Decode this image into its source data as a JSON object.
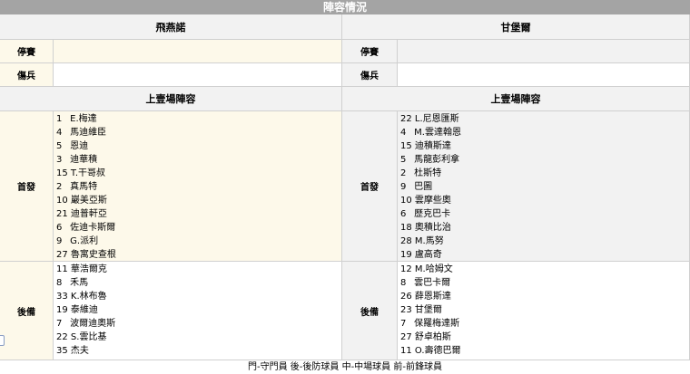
{
  "title": "陣容情況",
  "teams": {
    "home": "飛燕諾",
    "away": "甘堡爾"
  },
  "labels": {
    "suspended": "停賽",
    "injured": "傷兵",
    "last_lineup": "上壹場陣容",
    "starters": "首發",
    "subs": "後備"
  },
  "home": {
    "suspended": "",
    "injured": "",
    "starters": [
      {
        "num": "1",
        "name": "E.梅達"
      },
      {
        "num": "4",
        "name": "馬迪維臣"
      },
      {
        "num": "5",
        "name": "恩迪"
      },
      {
        "num": "3",
        "name": "迪華積"
      },
      {
        "num": "15",
        "name": "T.干哥叔"
      },
      {
        "num": "2",
        "name": "真馬特"
      },
      {
        "num": "10",
        "name": "巖美亞斯"
      },
      {
        "num": "21",
        "name": "迪普軒亞"
      },
      {
        "num": "6",
        "name": "佐迪卡斯爾"
      },
      {
        "num": "9",
        "name": "G.派利"
      },
      {
        "num": "27",
        "name": "魯寓史查根"
      }
    ],
    "subs": [
      {
        "num": "11",
        "name": "華浩爾克"
      },
      {
        "num": "8",
        "name": "禾馬"
      },
      {
        "num": "33",
        "name": "K.林布魯"
      },
      {
        "num": "19",
        "name": "泰維迪"
      },
      {
        "num": "7",
        "name": "波爾迪奧斯"
      },
      {
        "num": "22",
        "name": "S.雲比基"
      },
      {
        "num": "35",
        "name": "杰夫"
      }
    ]
  },
  "away": {
    "suspended": "",
    "injured": "",
    "starters": [
      {
        "num": "22",
        "name": "L.尼恩匯斯"
      },
      {
        "num": "4",
        "name": "M.雲達翰恩"
      },
      {
        "num": "15",
        "name": "迪積斯達"
      },
      {
        "num": "5",
        "name": "馬龍彭利拿"
      },
      {
        "num": "2",
        "name": "杜斯特"
      },
      {
        "num": "9",
        "name": "巴圖"
      },
      {
        "num": "10",
        "name": "雲摩些奧"
      },
      {
        "num": "6",
        "name": "歷克巴卡"
      },
      {
        "num": "18",
        "name": "奧積比治"
      },
      {
        "num": "28",
        "name": "M.馬努"
      },
      {
        "num": "19",
        "name": "盧高奇"
      }
    ],
    "subs": [
      {
        "num": "12",
        "name": "M.哈姆文"
      },
      {
        "num": "8",
        "name": "雲巴卡爾"
      },
      {
        "num": "26",
        "name": "薛恩斯達"
      },
      {
        "num": "23",
        "name": "甘堡爾"
      },
      {
        "num": "7",
        "name": "保羅梅達斯"
      },
      {
        "num": "27",
        "name": "舒卓柏斯"
      },
      {
        "num": "11",
        "name": "O.壽德巴爾"
      }
    ]
  },
  "legend": "門-守門員 後-後防球員 中-中場球員 前-前鋒球員"
}
